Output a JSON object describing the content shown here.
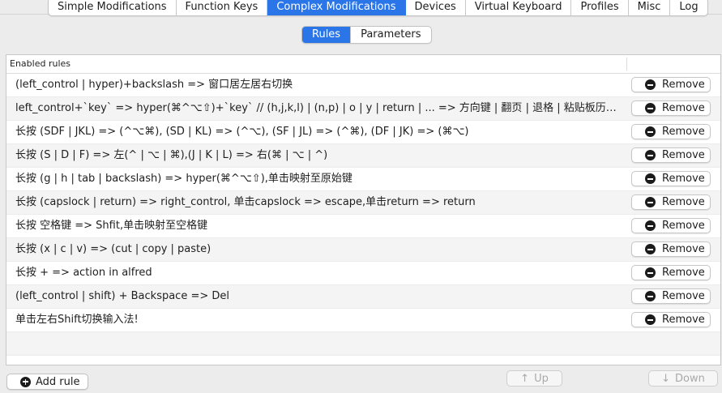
{
  "tabs": [
    {
      "label": "Simple Modifications",
      "active": false
    },
    {
      "label": "Function Keys",
      "active": false
    },
    {
      "label": "Complex Modifications",
      "active": true
    },
    {
      "label": "Devices",
      "active": false
    },
    {
      "label": "Virtual Keyboard",
      "active": false
    },
    {
      "label": "Profiles",
      "active": false
    },
    {
      "label": "Misc",
      "active": false
    },
    {
      "label": "Log",
      "active": false
    }
  ],
  "segment": {
    "rules_label": "Rules",
    "parameters_label": "Parameters"
  },
  "table": {
    "header": "Enabled rules",
    "remove_label": "Remove",
    "rows": [
      "(left_control | hyper)+backslash => 窗口居左居右切换",
      "left_control+`key` => hyper(⌘^⌥⇧)+`key` // (h,j,k,l) | (n,p) | o | y | return | ... => 方向键 | 翻页 | 退格 | 粘贴板历史 | 切换窗口 | 切换应用",
      "长按 (SDF | JKL) => (^⌥⌘), (SD | KL) => (^⌥), (SF | JL) => (^⌘), (DF | JK) => (⌘⌥)",
      "长按 (S | D | F) => 左(^ | ⌥ | ⌘),(J | K | L) => 右(⌘ | ⌥ | ^)",
      "长按 (g | h | tab | backslash) => hyper(⌘^⌥⇧),单击映射至原始键",
      "长按 (capslock | return) => right_control, 单击capslock => escape,单击return => return",
      "长按 空格键 => Shfit,单击映射至空格键",
      "长按 (x | c | v) => (cut | copy | paste)",
      "长按 + => action in alfred",
      "(left_control | shift) + Backspace  =>  Del",
      "单击左右Shift切换输入法!"
    ]
  },
  "bottom": {
    "add_rule_label": "Add rule",
    "up_label": "Up",
    "down_label": "Down"
  },
  "colors": {
    "accent": "#2a75e8",
    "window_bg": "#ececec",
    "alt_row": "#f4f4f5"
  }
}
